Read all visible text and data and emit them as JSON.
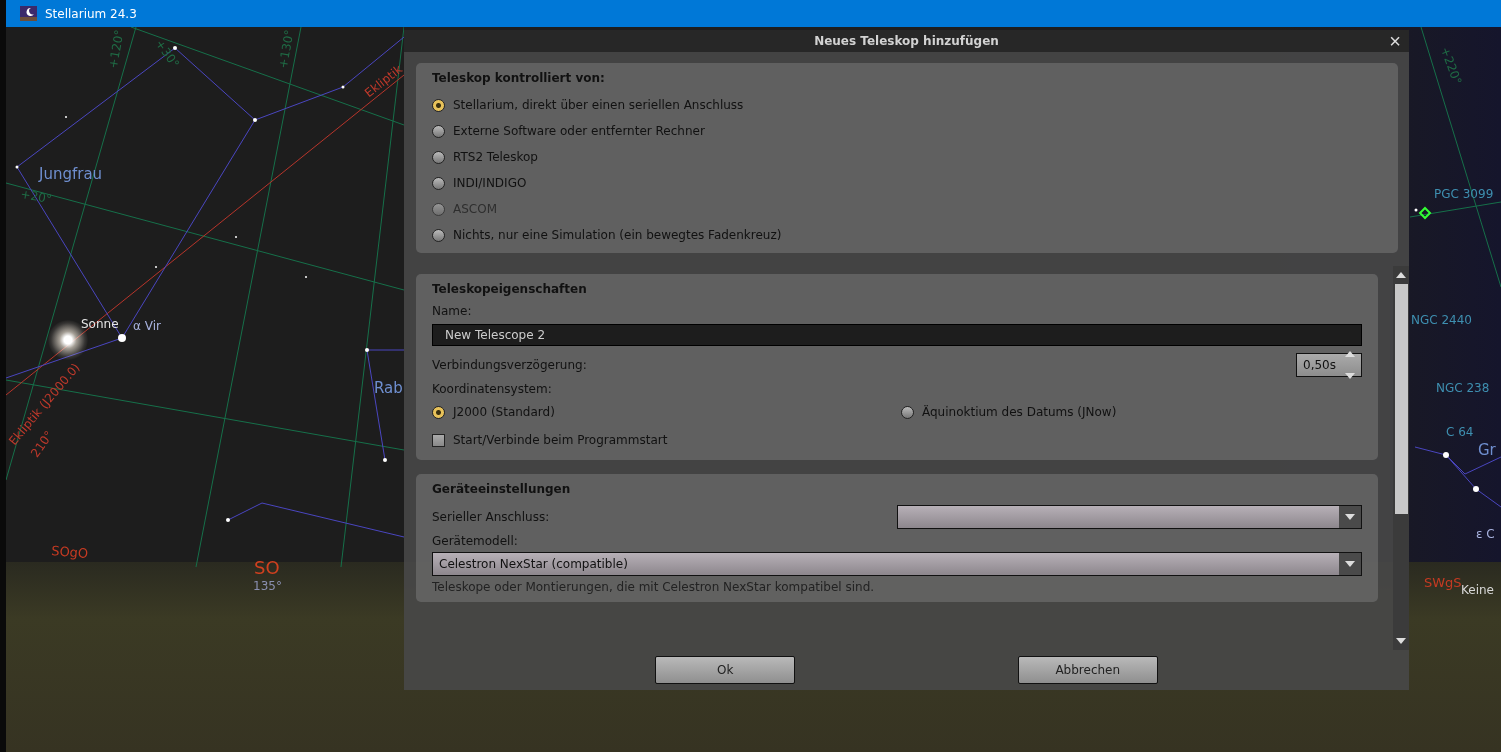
{
  "window": {
    "title": "Stellarium 24.3"
  },
  "sky_labels": [
    {
      "text": "Jungfrau",
      "kind": "constellation"
    },
    {
      "text": "Sonne",
      "kind": "planet"
    },
    {
      "text": "α Vir",
      "kind": "star"
    },
    {
      "text": "Ekliptik",
      "kind": "ecliptic"
    },
    {
      "text": "Ekliptik (J2000.0)",
      "kind": "ecliptic"
    },
    {
      "text": "210°",
      "kind": "ecliptic"
    },
    {
      "text": "+120°",
      "kind": "grid"
    },
    {
      "text": "+30°",
      "kind": "grid"
    },
    {
      "text": "+130°",
      "kind": "grid"
    },
    {
      "text": "+20°",
      "kind": "grid"
    },
    {
      "text": "Rab",
      "kind": "constellation"
    },
    {
      "text": "SOgO",
      "kind": "cardinal"
    },
    {
      "text": "SO",
      "kind": "cardinal_major"
    },
    {
      "text": "135°",
      "kind": "degree"
    },
    {
      "text": "+220°",
      "kind": "grid"
    },
    {
      "text": "PGC 3099",
      "kind": "deepsky"
    },
    {
      "text": "NGC 2440",
      "kind": "deepsky"
    },
    {
      "text": "NGC 238",
      "kind": "deepsky"
    },
    {
      "text": "C 64",
      "kind": "deepsky"
    },
    {
      "text": "Gr",
      "kind": "constellation"
    },
    {
      "text": "ε C",
      "kind": "star"
    },
    {
      "text": "SWgS",
      "kind": "cardinal"
    },
    {
      "text": "Keine",
      "kind": "landscape"
    }
  ],
  "dialog": {
    "title": "Neues Teleskop hinzufügen",
    "close": "×",
    "control_group": {
      "title": "Teleskop kontrolliert von:",
      "options": [
        {
          "label": "Stellarium, direkt über einen seriellen Anschluss",
          "selected": true
        },
        {
          "label": "Externe Software oder entfernter Rechner",
          "selected": false
        },
        {
          "label": "RTS2 Teleskop",
          "selected": false
        },
        {
          "label": "INDI/INDIGO",
          "selected": false
        },
        {
          "label": "ASCOM",
          "selected": false,
          "disabled": true
        },
        {
          "label": "Nichts, nur eine Simulation (ein bewegtes Fadenkreuz)",
          "selected": false
        }
      ]
    },
    "properties_group": {
      "title": "Teleskopeigenschaften",
      "name_label": "Name:",
      "name_value": "New Telescope 2",
      "delay_label": "Verbindungsverzögerung:",
      "delay_value": "0,50s",
      "coords_label": "Koordinatensystem:",
      "coord_options": [
        {
          "label": "J2000 (Standard)",
          "selected": true
        },
        {
          "label": "Äquinoktium des Datums (JNow)",
          "selected": false
        }
      ],
      "autostart": {
        "label": "Start/Verbinde beim Programmstart",
        "checked": false
      }
    },
    "device_group": {
      "title": "Geräteeinstellungen",
      "serial_label": "Serieller Anschluss:",
      "model_label": "Gerätemodell:",
      "model_value": "Celestron NexStar (compatible)",
      "note": "Teleskope oder Montierungen, die mit Celestron NexStar kompatibel sind."
    },
    "buttons": [
      "Ok",
      "Abbrechen"
    ]
  }
}
